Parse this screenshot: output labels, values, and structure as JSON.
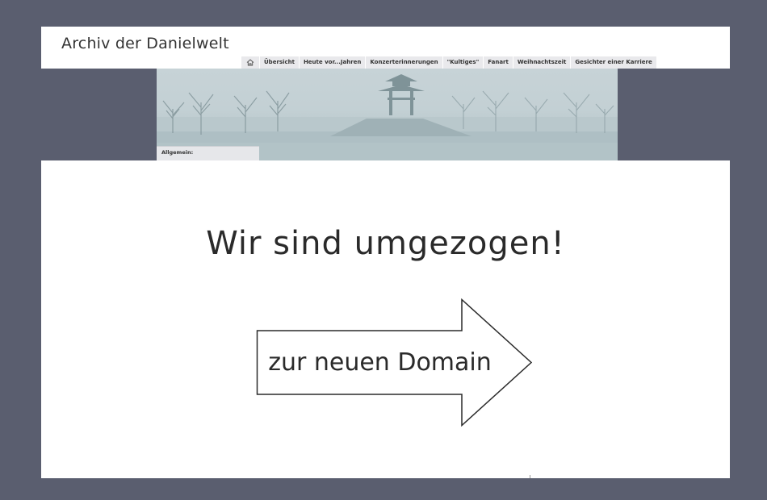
{
  "header": {
    "site_title": "Archiv der Danielwelt"
  },
  "nav": {
    "home_icon": "home-icon",
    "items": [
      {
        "label": "Übersicht"
      },
      {
        "label": "Heute vor...Jahren"
      },
      {
        "label": "Konzerterinnerungen"
      },
      {
        "label": "\"Kultiges\""
      },
      {
        "label": "Fanart"
      },
      {
        "label": "Weihnachtszeit"
      },
      {
        "label": "Gesichter einer Karriere"
      }
    ]
  },
  "sidebar": {
    "section_label": "Allgemein:"
  },
  "notice": {
    "headline": "Wir sind umgezogen!",
    "link_label": "zur neuen Domain"
  },
  "colors": {
    "page_background": "#5a5e6f",
    "card_background": "#ffffff",
    "text": "#2a2a2a"
  }
}
